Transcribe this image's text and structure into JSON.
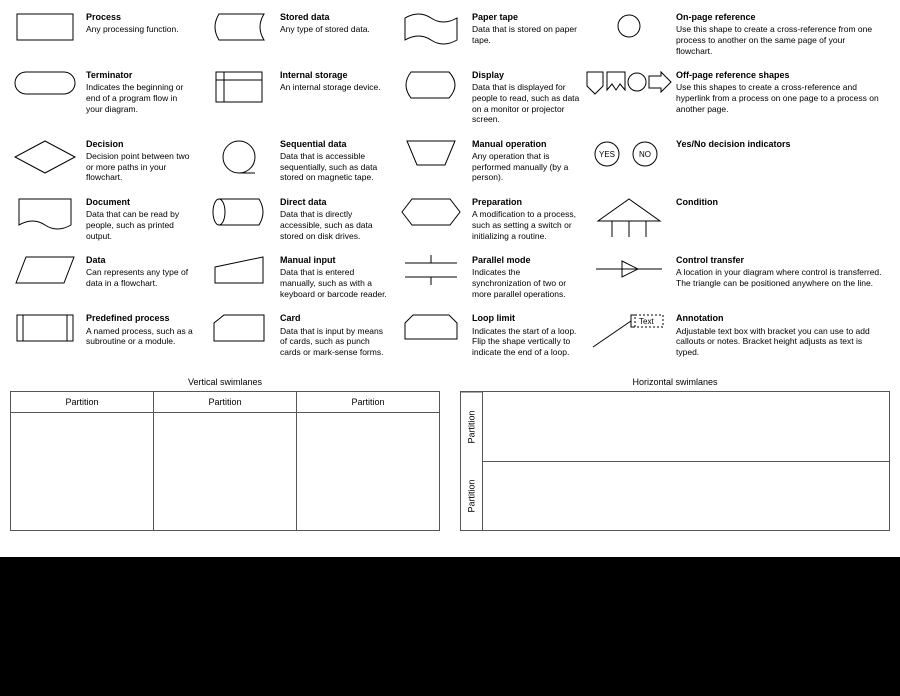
{
  "shapes": {
    "process": {
      "title": "Process",
      "desc": "Any processing function."
    },
    "terminator": {
      "title": "Terminator",
      "desc": "Indicates the beginning or end of a program flow in your diagram."
    },
    "decision": {
      "title": "Decision",
      "desc": "Decision point between two or more paths in your flowchart."
    },
    "document": {
      "title": "Document",
      "desc": "Data that can be read by people, such as printed output."
    },
    "data": {
      "title": "Data",
      "desc": "Can represents any type of data in a flowchart."
    },
    "predefined": {
      "title": "Predefined process",
      "desc": "A named process, such as a subroutine or a module."
    },
    "stored": {
      "title": "Stored data",
      "desc": "Any type of stored data."
    },
    "internal": {
      "title": "Internal storage",
      "desc": "An internal storage device."
    },
    "sequential": {
      "title": "Sequential data",
      "desc": "Data that is accessible sequentially, such as data stored on magnetic tape."
    },
    "direct": {
      "title": "Direct data",
      "desc": "Data that is directly accessible, such as data stored on disk drives."
    },
    "manualinput": {
      "title": "Manual input",
      "desc": "Data that is entered manually, such as with a keyboard or barcode reader."
    },
    "card": {
      "title": "Card",
      "desc": "Data that is input by means of cards, such as punch cards or mark-sense forms."
    },
    "papertape": {
      "title": "Paper tape",
      "desc": "Data that is stored on paper tape."
    },
    "display": {
      "title": "Display",
      "desc": "Data that is displayed for people to read, such as data on a monitor or projector screen."
    },
    "manualop": {
      "title": "Manual operation",
      "desc": "Any operation that is performed manually (by a person)."
    },
    "preparation": {
      "title": "Preparation",
      "desc": "A modification to a process, such as setting a switch or initializing a routine."
    },
    "parallel": {
      "title": "Parallel mode",
      "desc": "Indicates the synchronization of two or more parallel operations."
    },
    "looplimit": {
      "title": "Loop limit",
      "desc": "Indicates the start of a loop. Flip the shape vertically to indicate the end of a loop."
    },
    "onpage": {
      "title": "On-page reference",
      "desc": "Use this shape to create a cross-reference from one process to another on the same page of your flowchart."
    },
    "offpage": {
      "title": "Off-page reference shapes",
      "desc": "Use this shapes to create a cross-reference and hyperlink from a process on one page to a process on another page."
    },
    "yesno": {
      "title": "Yes/No decision indicators",
      "yes": "YES",
      "no": "NO"
    },
    "condition": {
      "title": "Condition"
    },
    "control": {
      "title": "Control transfer",
      "desc": "A location in your diagram where control is transferred. The triangle can be positioned anywhere on the line."
    },
    "annotation": {
      "title": "Annotation",
      "desc": "Adjustable text box with bracket you can use to add callouts or notes. Bracket height adjusts as text is typed.",
      "text": "Text"
    }
  },
  "swimlanes": {
    "vertical_title": "Vertical swimlanes",
    "horizontal_title": "Horizontal swimlanes",
    "partition": "Partition"
  }
}
